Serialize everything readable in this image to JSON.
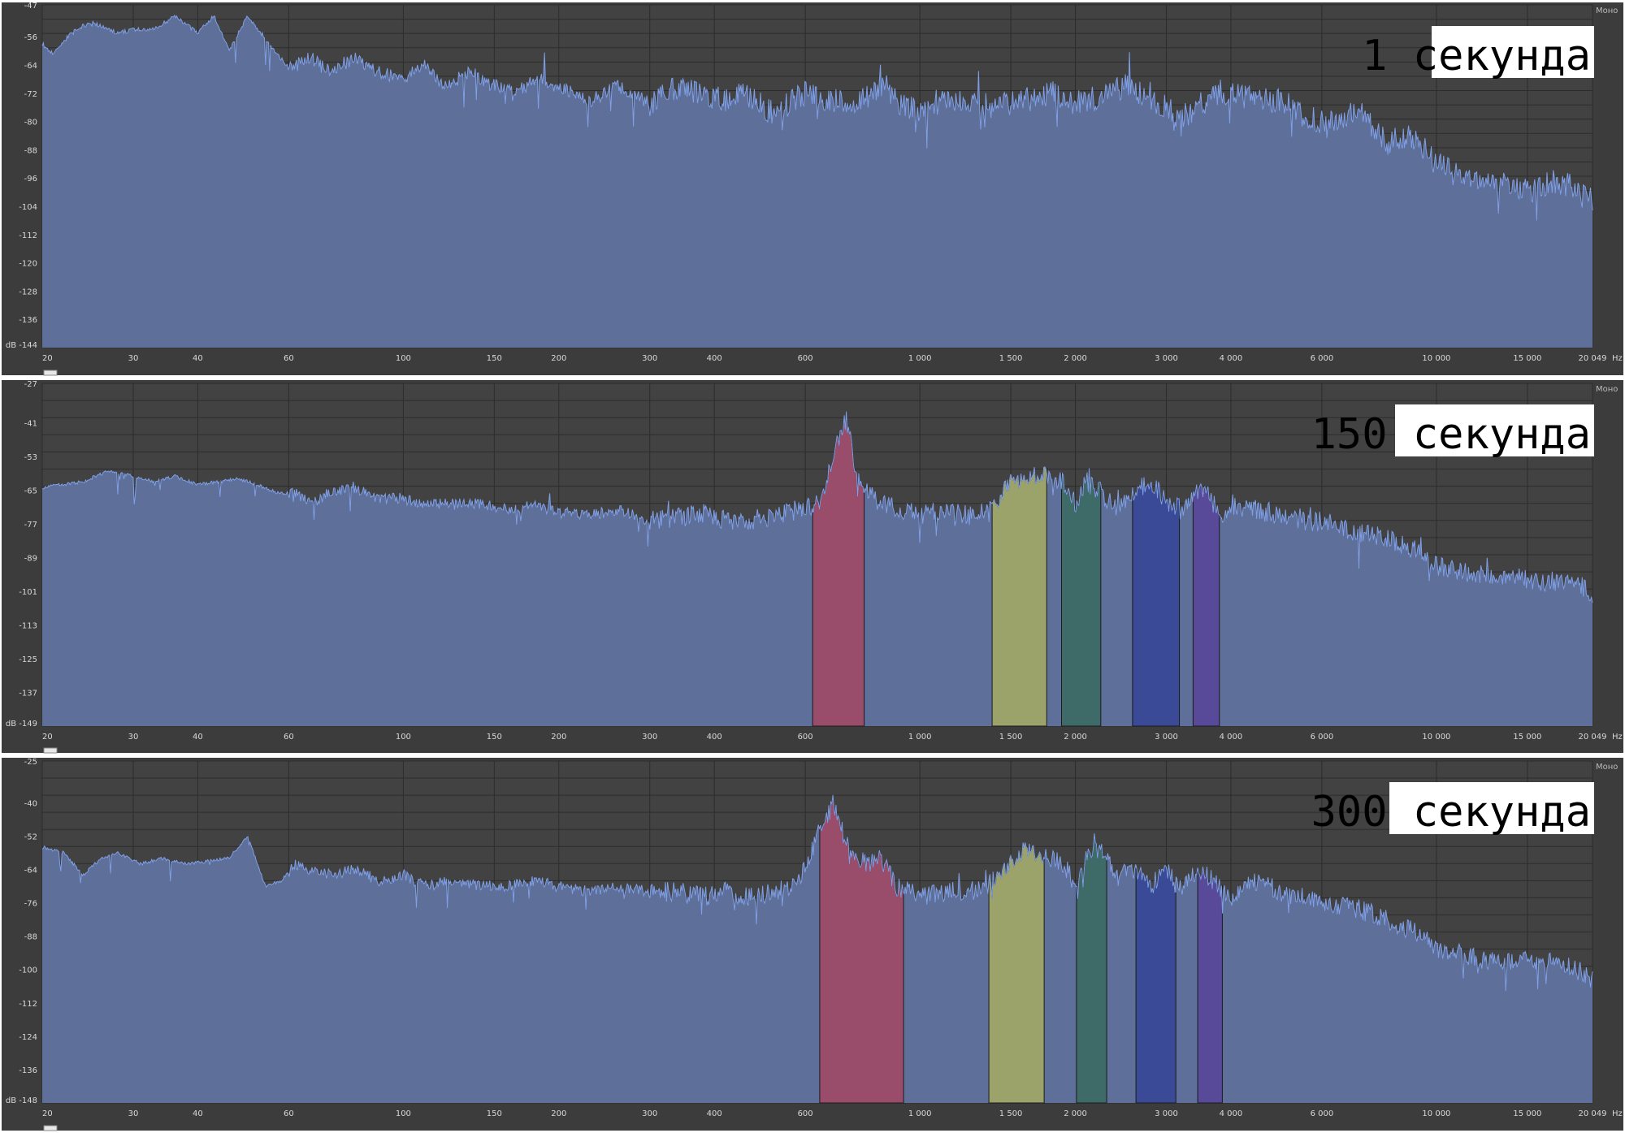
{
  "window": {
    "channel_label": "Моно",
    "db_unit": "dB",
    "hz_unit": "Hz"
  },
  "colors": {
    "background": "#3c3c3c",
    "plot": "#424242",
    "grid": "#2c2c2c",
    "fill": "#5e6f99",
    "line": "#7f9fe6",
    "separator": "#ffffff",
    "title_box": "#ffffff"
  },
  "chart_data": [
    {
      "type": "area",
      "title": "1 секунда",
      "x_scale": "log",
      "xlabel": "Hz",
      "ylabel": "dB",
      "x_ticks": [
        "20",
        "30",
        "40",
        "60",
        "100",
        "150",
        "200",
        "300",
        "400",
        "600",
        "1 000",
        "1 500",
        "2 000",
        "3 000",
        "4 000",
        "6 000",
        "10 000",
        "15 000",
        "20 049"
      ],
      "x_tick_values": [
        20,
        30,
        40,
        60,
        100,
        150,
        200,
        300,
        400,
        600,
        1000,
        1500,
        2000,
        3000,
        4000,
        6000,
        10000,
        15000,
        20049
      ],
      "y_ticks": [
        -47,
        -56,
        -64,
        -72,
        -80,
        -88,
        -96,
        -104,
        -112,
        -120,
        -128,
        -136,
        -144
      ],
      "ylim": [
        -144,
        -47
      ],
      "grid": true,
      "series": [
        {
          "x": [
            20,
            21,
            23,
            25,
            28,
            30,
            33,
            36,
            40,
            43,
            46,
            50,
            55,
            60,
            66,
            72,
            80,
            90,
            100,
            110,
            120,
            135,
            150,
            165,
            180,
            200,
            230,
            260,
            300,
            340,
            380,
            420,
            460,
            520,
            600,
            680,
            760,
            850,
            900,
            1000,
            1100,
            1250,
            1400,
            1600,
            1800,
            2000,
            2250,
            2500,
            2700,
            3000,
            3200,
            3600,
            4000,
            4500,
            5000,
            5500,
            6000,
            6500,
            7000,
            8000,
            9000,
            10000,
            11000,
            12000,
            13500,
            15000,
            16500,
            18000,
            19000,
            20049
          ],
          "values": [
            -58,
            -61,
            -54,
            -52,
            -55,
            -54,
            -54,
            -50,
            -55,
            -50,
            -60,
            -50,
            -58,
            -65,
            -62,
            -66,
            -62,
            -66,
            -68,
            -64,
            -70,
            -66,
            -70,
            -72,
            -68,
            -70,
            -74,
            -70,
            -75,
            -70,
            -72,
            -74,
            -72,
            -78,
            -72,
            -74,
            -75,
            -70,
            -74,
            -78,
            -74,
            -74,
            -76,
            -74,
            -72,
            -75,
            -73,
            -70,
            -72,
            -76,
            -79,
            -74,
            -72,
            -74,
            -74,
            -78,
            -80,
            -80,
            -76,
            -86,
            -84,
            -92,
            -94,
            -97,
            -98,
            -100,
            -97,
            -98,
            -101,
            -102
          ]
        }
      ],
      "highlight_bands": []
    },
    {
      "type": "area",
      "title": "150 секунда",
      "x_scale": "log",
      "xlabel": "Hz",
      "ylabel": "dB",
      "x_ticks": [
        "20",
        "30",
        "40",
        "60",
        "100",
        "150",
        "200",
        "300",
        "400",
        "600",
        "1 000",
        "1 500",
        "2 000",
        "3 000",
        "4 000",
        "6 000",
        "10 000",
        "15 000",
        "20 049"
      ],
      "x_tick_values": [
        20,
        30,
        40,
        60,
        100,
        150,
        200,
        300,
        400,
        600,
        1000,
        1500,
        2000,
        3000,
        4000,
        6000,
        10000,
        15000,
        20049
      ],
      "y_ticks": [
        -27,
        -41,
        -53,
        -65,
        -77,
        -89,
        -101,
        -113,
        -125,
        -137,
        -149
      ],
      "ylim": [
        -149,
        -27
      ],
      "grid": true,
      "series": [
        {
          "x": [
            20,
            22,
            24,
            27,
            30,
            33,
            36,
            40,
            44,
            48,
            52,
            57,
            62,
            66,
            72,
            80,
            90,
            100,
            110,
            125,
            140,
            160,
            180,
            200,
            230,
            260,
            300,
            340,
            380,
            420,
            460,
            520,
            580,
            640,
            680,
            720,
            760,
            820,
            900,
            1000,
            1100,
            1250,
            1400,
            1500,
            1600,
            1800,
            1900,
            2000,
            2100,
            2250,
            2400,
            2600,
            2800,
            3000,
            3200,
            3400,
            3600,
            3800,
            4000,
            4500,
            5000,
            5500,
            6000,
            7000,
            8000,
            9000,
            10000,
            11000,
            12000,
            14000,
            16000,
            18000,
            19000,
            20049
          ],
          "values": [
            -64,
            -63,
            -62,
            -58,
            -60,
            -62,
            -60,
            -63,
            -62,
            -61,
            -63,
            -66,
            -66,
            -70,
            -66,
            -64,
            -68,
            -68,
            -70,
            -70,
            -70,
            -72,
            -70,
            -73,
            -74,
            -72,
            -76,
            -75,
            -73,
            -76,
            -76,
            -74,
            -72,
            -70,
            -52,
            -40,
            -62,
            -68,
            -72,
            -74,
            -72,
            -74,
            -70,
            -62,
            -60,
            -60,
            -63,
            -70,
            -62,
            -66,
            -72,
            -66,
            -62,
            -68,
            -72,
            -66,
            -66,
            -74,
            -70,
            -72,
            -74,
            -76,
            -76,
            -80,
            -82,
            -86,
            -92,
            -94,
            -95,
            -96,
            -98,
            -97,
            -99,
            -102
          ]
        }
      ],
      "highlight_bands": [
        {
          "from": 620,
          "to": 780,
          "color": "#9a4c6b"
        },
        {
          "from": 1380,
          "to": 1760,
          "color": "#9ba36a"
        },
        {
          "from": 1880,
          "to": 2240,
          "color": "#3e6b68"
        },
        {
          "from": 2580,
          "to": 3180,
          "color": "#3a4a96"
        },
        {
          "from": 3380,
          "to": 3800,
          "color": "#584a98"
        }
      ]
    },
    {
      "type": "area",
      "title": "300 секунда",
      "x_scale": "log",
      "xlabel": "Hz",
      "ylabel": "dB",
      "x_ticks": [
        "20",
        "30",
        "40",
        "60",
        "100",
        "150",
        "200",
        "300",
        "400",
        "600",
        "1 000",
        "1 500",
        "2 000",
        "3 000",
        "4 000",
        "6 000",
        "10 000",
        "15 000",
        "20 049"
      ],
      "x_tick_values": [
        20,
        30,
        40,
        60,
        100,
        150,
        200,
        300,
        400,
        600,
        1000,
        1500,
        2000,
        3000,
        4000,
        6000,
        10000,
        15000,
        20049
      ],
      "y_ticks": [
        -25,
        -40,
        -52,
        -64,
        -76,
        -88,
        -100,
        -112,
        -124,
        -136,
        -148
      ],
      "ylim": [
        -148,
        -25
      ],
      "grid": true,
      "series": [
        {
          "x": [
            20,
            22,
            24,
            26,
            28,
            31,
            34,
            38,
            42,
            46,
            50,
            54,
            58,
            62,
            66,
            72,
            80,
            90,
            100,
            110,
            125,
            140,
            160,
            180,
            200,
            230,
            260,
            300,
            340,
            380,
            420,
            460,
            520,
            580,
            640,
            680,
            720,
            780,
            840,
            900,
            1000,
            1100,
            1250,
            1400,
            1500,
            1600,
            1800,
            1900,
            2000,
            2100,
            2250,
            2400,
            2600,
            2800,
            3000,
            3200,
            3400,
            3600,
            3800,
            4000,
            4500,
            5000,
            5500,
            6000,
            7000,
            8000,
            9000,
            10000,
            11000,
            12000,
            14000,
            16000,
            18000,
            19000,
            20049
          ],
          "values": [
            -56,
            -58,
            -66,
            -60,
            -58,
            -62,
            -60,
            -62,
            -61,
            -60,
            -52,
            -70,
            -68,
            -62,
            -64,
            -66,
            -64,
            -68,
            -66,
            -70,
            -68,
            -70,
            -70,
            -68,
            -70,
            -72,
            -70,
            -72,
            -72,
            -74,
            -72,
            -74,
            -72,
            -70,
            -50,
            -40,
            -55,
            -62,
            -60,
            -70,
            -74,
            -72,
            -72,
            -68,
            -62,
            -56,
            -60,
            -62,
            -70,
            -60,
            -56,
            -66,
            -64,
            -70,
            -64,
            -70,
            -66,
            -66,
            -70,
            -74,
            -68,
            -72,
            -74,
            -76,
            -78,
            -82,
            -86,
            -92,
            -94,
            -96,
            -98,
            -96,
            -99,
            -101,
            -104
          ]
        }
      ],
      "highlight_bands": [
        {
          "from": 640,
          "to": 930,
          "color": "#9a4c6b"
        },
        {
          "from": 1360,
          "to": 1740,
          "color": "#9ba36a"
        },
        {
          "from": 2010,
          "to": 2300,
          "color": "#3e6b68"
        },
        {
          "from": 2620,
          "to": 3130,
          "color": "#3a4a96"
        },
        {
          "from": 3450,
          "to": 3850,
          "color": "#584a98"
        }
      ]
    }
  ]
}
